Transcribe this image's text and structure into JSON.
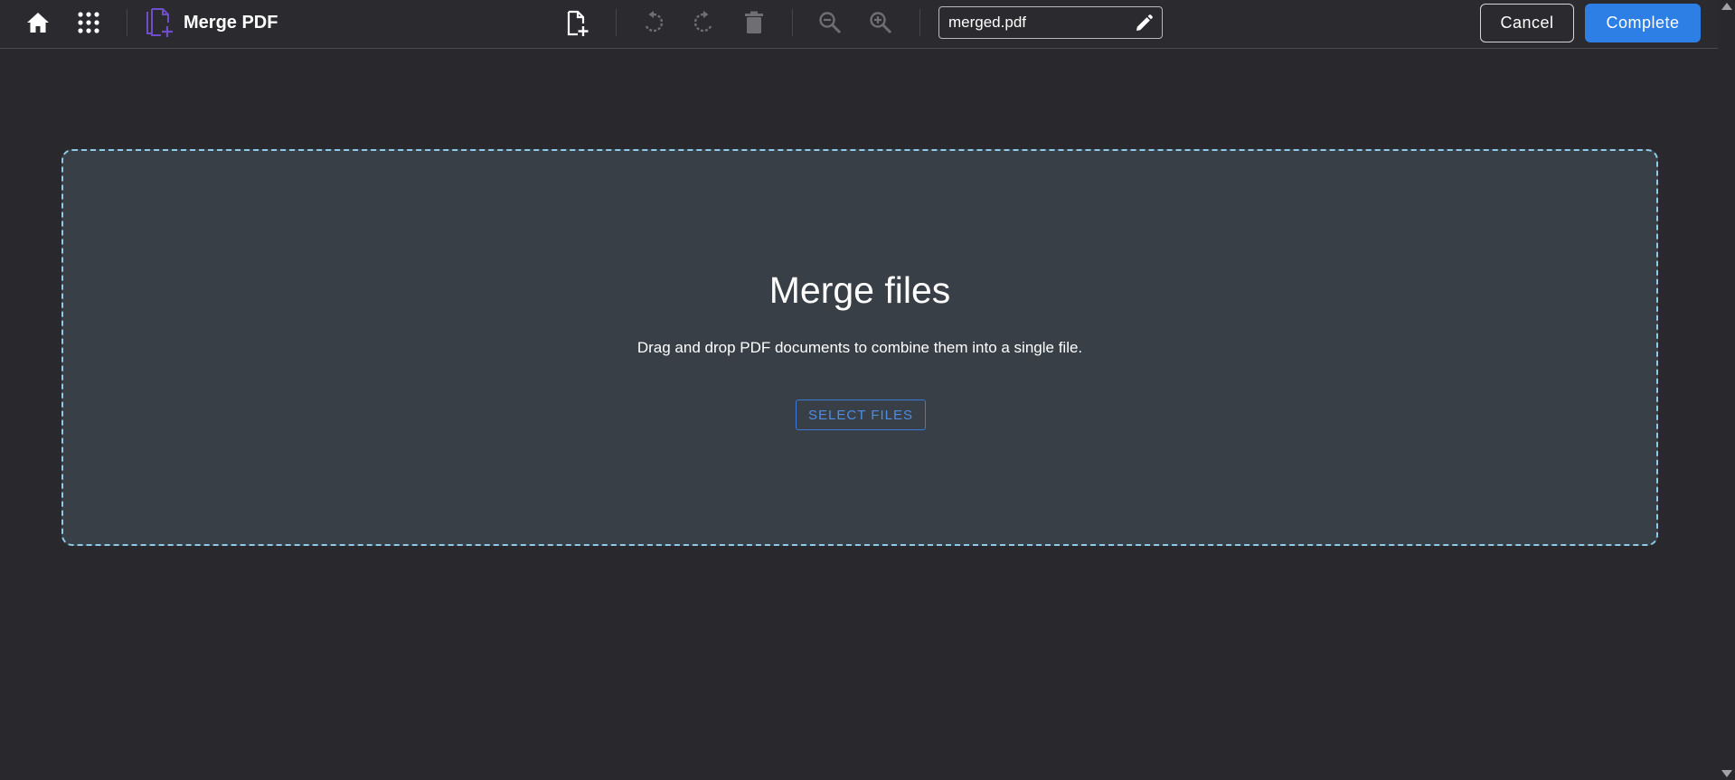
{
  "toolbar": {
    "app_title": "Merge PDF",
    "filename": "merged.pdf",
    "cancel_label": "Cancel",
    "complete_label": "Complete",
    "icons": [
      "home-icon",
      "apps-grid-icon",
      "merge-pdf-logo-icon",
      "add-file-icon",
      "rotate-left-icon",
      "rotate-right-icon",
      "trash-icon",
      "zoom-out-icon",
      "zoom-in-icon",
      "pencil-icon"
    ]
  },
  "dropzone": {
    "title": "Merge files",
    "subtitle": "Drag and drop PDF documents to combine them into a single file.",
    "select_label": "SELECT FILES"
  },
  "colors": {
    "background": "#29282d",
    "toolbar": "#2b2a2f",
    "dropzone_bg": "#383f47",
    "dropzone_border": "#8ecbea",
    "accent": "#2d7ee5",
    "logo": "#6e4fc9"
  }
}
